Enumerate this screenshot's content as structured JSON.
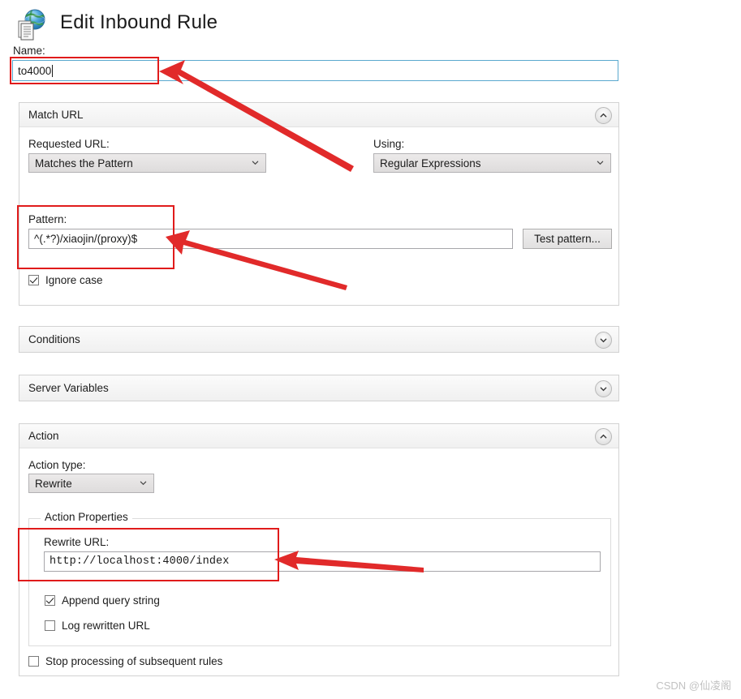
{
  "dialog": {
    "title": "Edit Inbound Rule",
    "icon": "globe-document-icon",
    "name_label": "Name:",
    "name_value": "to4000"
  },
  "match_url": {
    "section_title": "Match URL",
    "expander_state": "expanded",
    "requested_url_label": "Requested URL:",
    "requested_url_value": "Matches the Pattern",
    "using_label": "Using:",
    "using_value": "Regular Expressions",
    "pattern_label": "Pattern:",
    "pattern_value": "^(.*?)/xiaojin/(proxy)$",
    "test_pattern_button": "Test pattern...",
    "ignore_case_label": "Ignore case",
    "ignore_case_checked": true
  },
  "conditions": {
    "section_title": "Conditions",
    "expander_state": "collapsed"
  },
  "server_variables": {
    "section_title": "Server Variables",
    "expander_state": "collapsed"
  },
  "action": {
    "section_title": "Action",
    "expander_state": "expanded",
    "action_type_label": "Action type:",
    "action_type_value": "Rewrite",
    "properties_legend": "Action Properties",
    "rewrite_url_label": "Rewrite URL:",
    "rewrite_url_value": "http://localhost:4000/index",
    "append_query_string_label": "Append query string",
    "append_query_string_checked": true,
    "log_rewritten_url_label": "Log rewritten URL",
    "log_rewritten_url_checked": false,
    "stop_processing_label": "Stop processing of subsequent rules",
    "stop_processing_checked": false
  },
  "annotations": {
    "highlight_color": "#e01b1b",
    "arrow_color": "#e12a2a",
    "count": 3
  },
  "watermark": {
    "text": "CSDN @仙凌阁"
  }
}
